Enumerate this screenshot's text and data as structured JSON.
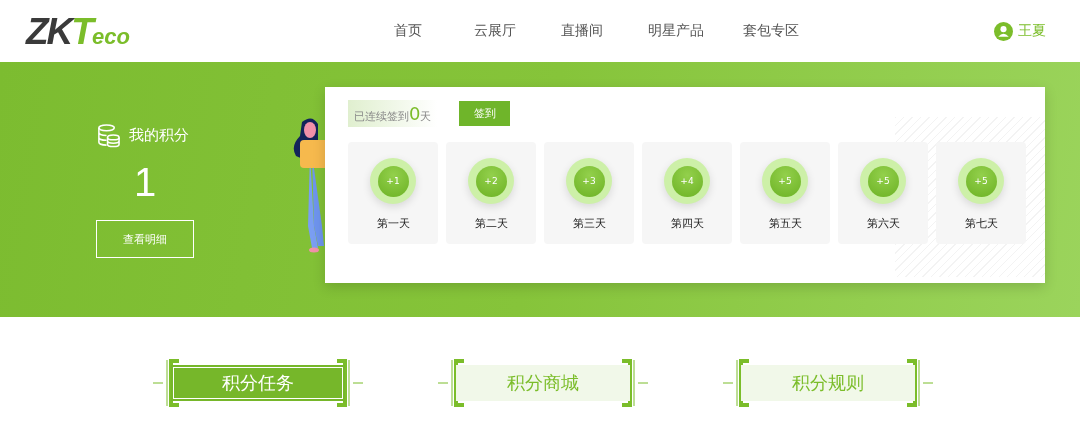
{
  "logo": {
    "dark": "ZK",
    "accent": "T",
    "small": "eco"
  },
  "nav": [
    {
      "label": "首页"
    },
    {
      "label": "云展厅"
    },
    {
      "label": "直播间"
    },
    {
      "label": "明星产品"
    },
    {
      "label": "套包专区"
    }
  ],
  "user": {
    "name": "王夏"
  },
  "points": {
    "title": "我的积分",
    "value": "1",
    "details_button": "查看明细"
  },
  "signin": {
    "streak_prefix": "已连续签到",
    "streak_count": "0",
    "streak_suffix": "天",
    "button": "签到",
    "days": [
      {
        "reward": "+1",
        "label": "第一天"
      },
      {
        "reward": "+2",
        "label": "第二天"
      },
      {
        "reward": "+3",
        "label": "第三天"
      },
      {
        "reward": "+4",
        "label": "第四天"
      },
      {
        "reward": "+5",
        "label": "第五天"
      },
      {
        "reward": "+5",
        "label": "第六天"
      },
      {
        "reward": "+5",
        "label": "第七天"
      }
    ]
  },
  "tabs": [
    {
      "label": "积分任务",
      "selected": true
    },
    {
      "label": "积分商城",
      "selected": false
    },
    {
      "label": "积分规则",
      "selected": false
    }
  ]
}
